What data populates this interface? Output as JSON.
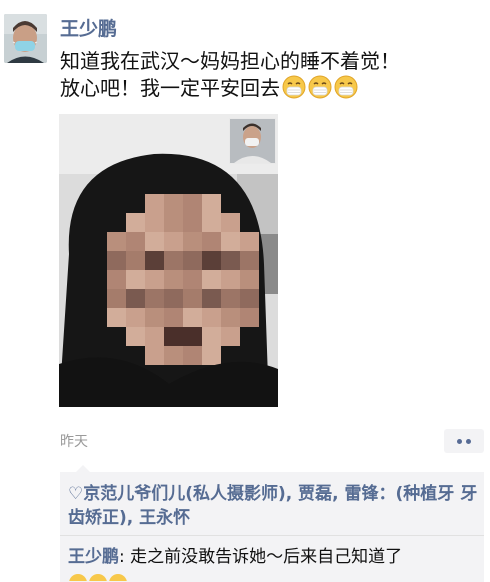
{
  "post": {
    "author": "王少鹏",
    "text_line1": "知道我在武汉～妈妈担心的睡不着觉！",
    "text_line2": "放心吧！我一定平安回去",
    "emoji_name": "mask-face-emoji",
    "emoji_count": 3,
    "time": "昨天"
  },
  "likes": {
    "icon": "heart-outline-icon",
    "heart_glyph": "♡",
    "names": "京范儿爷们儿(私人摄影师), 贾磊, 雷锋：(种植牙 牙齿矫正), 王永怀"
  },
  "comments": [
    {
      "author": "王少鹏",
      "separator": ":",
      "text": "走之前没敢告诉她～后来自己知道了"
    }
  ],
  "colors": {
    "name_blue": "#566c93",
    "panel_bg": "#f3f3f5",
    "muted": "#9a9a9a"
  }
}
